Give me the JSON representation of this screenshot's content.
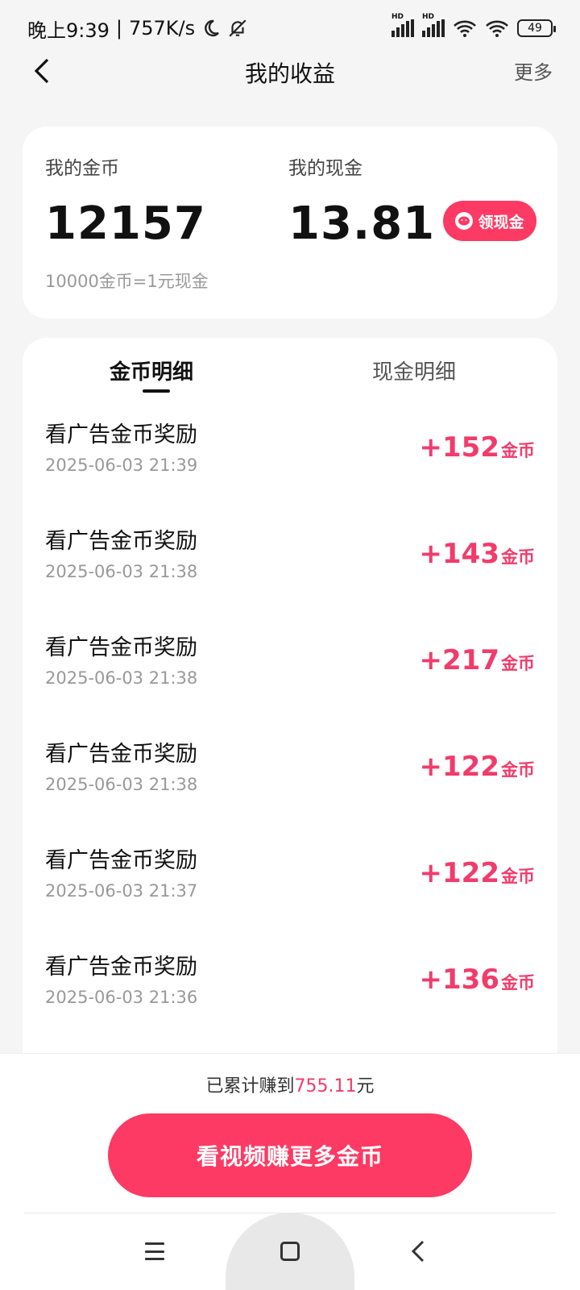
{
  "status_bar": {
    "time": "晚上9:39",
    "separator": "|",
    "speed": "757K/s",
    "battery": "49",
    "hd_label": "HD",
    "icons": [
      "moon-icon",
      "bell-off-icon",
      "signal-icon",
      "signal-icon",
      "wifi-icon",
      "wifi-icon",
      "battery-icon"
    ]
  },
  "header": {
    "back_icon": "chevron-left-icon",
    "title": "我的收益",
    "more_label": "更多"
  },
  "earnings": {
    "coins_label": "我的金币",
    "coins_value": "12157",
    "cash_label": "我的现金",
    "cash_value": "13.81",
    "claim_label": "领现金",
    "claim_icon": "wechat-icon",
    "rate_note": "10000金币=1元现金"
  },
  "tabs": [
    {
      "label": "金币明细",
      "active": true
    },
    {
      "label": "现金明细",
      "active": false
    }
  ],
  "records": [
    {
      "title": "看广告金币奖励",
      "time": "2025-06-03 21:39",
      "amount": "+152",
      "unit": "金币"
    },
    {
      "title": "看广告金币奖励",
      "time": "2025-06-03 21:38",
      "amount": "+143",
      "unit": "金币"
    },
    {
      "title": "看广告金币奖励",
      "time": "2025-06-03 21:38",
      "amount": "+217",
      "unit": "金币"
    },
    {
      "title": "看广告金币奖励",
      "time": "2025-06-03 21:38",
      "amount": "+122",
      "unit": "金币"
    },
    {
      "title": "看广告金币奖励",
      "time": "2025-06-03 21:37",
      "amount": "+122",
      "unit": "金币"
    },
    {
      "title": "看广告金币奖励",
      "time": "2025-06-03 21:36",
      "amount": "+136",
      "unit": "金币"
    }
  ],
  "footer": {
    "total_prefix": "已累计赚到",
    "total_amount": "755.11",
    "total_suffix": "元",
    "cta_label": "看视频赚更多金币"
  },
  "system_nav": {
    "icons": [
      "menu-icon",
      "home-square-icon",
      "back-chevron-icon"
    ]
  },
  "colors": {
    "accent": "#fc3a63",
    "amount_text": "#f23b6b",
    "background": "#f5f5f5"
  }
}
